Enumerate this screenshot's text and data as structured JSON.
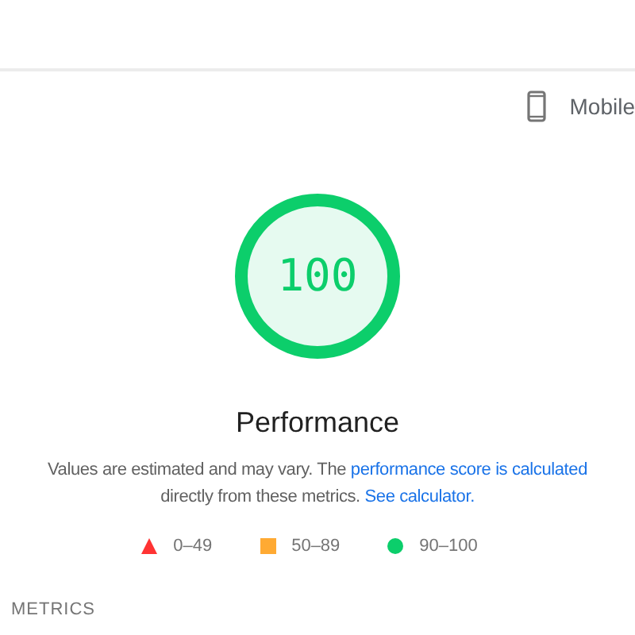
{
  "device": {
    "label": "Mobile"
  },
  "gauge": {
    "score": "100",
    "level": 1,
    "color": "#0cce6b"
  },
  "title": "Performance",
  "description": [
    {
      "kind": "text",
      "text": "Values are estimated and may vary. The "
    },
    {
      "kind": "link",
      "text": "performance score is calculated"
    },
    {
      "kind": "text",
      "text": " directly from these metrics. "
    },
    {
      "kind": "link",
      "text": "See calculator."
    }
  ],
  "legend": [
    {
      "kind": "triangle",
      "color": "#ff3333",
      "label": "0–49"
    },
    {
      "kind": "square",
      "color": "#ffaa33",
      "label": "50–89"
    },
    {
      "kind": "circle",
      "color": "#0cce6b",
      "label": "90–100"
    }
  ],
  "section_heading": "METRICS"
}
